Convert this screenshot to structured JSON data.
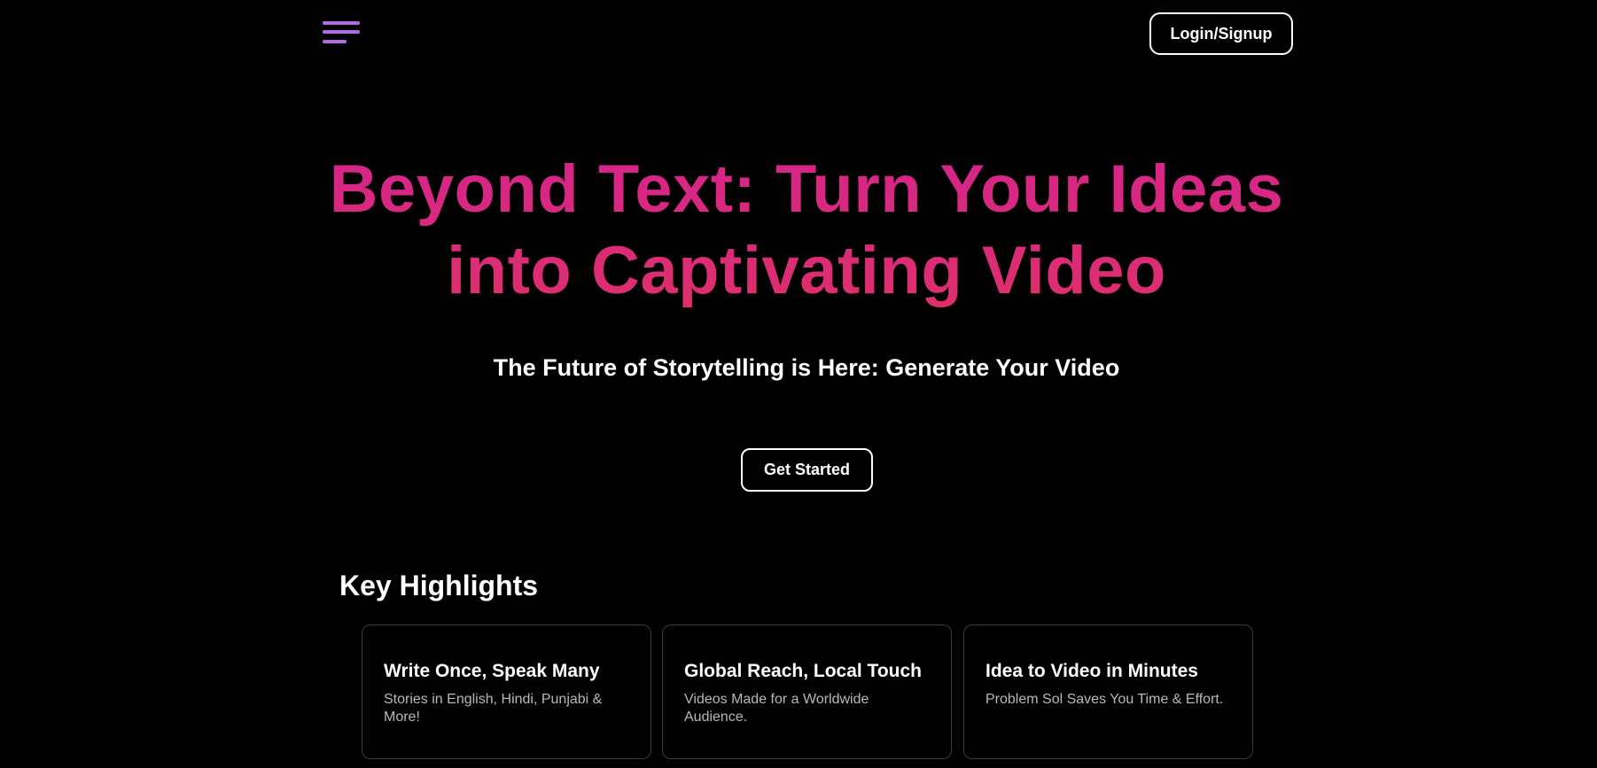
{
  "header": {
    "menu_icon": "hamburger-menu-icon",
    "login_label": "Login/Signup"
  },
  "hero": {
    "title_line1": "Beyond Text: Turn Your Ideas",
    "title_line2": "into Captivating Video",
    "subtitle": "The Future of Storytelling is Here: Generate Your Video",
    "cta_label": "Get Started"
  },
  "highlights": {
    "heading": "Key Highlights",
    "cards": [
      {
        "title": "Write Once, Speak Many",
        "text": "Stories in English, Hindi, Punjabi & More!"
      },
      {
        "title": "Global Reach, Local Touch",
        "text": "Videos Made for a Worldwide Audience."
      },
      {
        "title": "Idea to Video in Minutes",
        "text": "Problem Sol Saves You Time & Effort."
      }
    ]
  },
  "colors": {
    "background": "#000000",
    "accent_pink": "#d5248c",
    "accent_red": "#de2f6b",
    "menu_purple": "#b46ae6"
  }
}
